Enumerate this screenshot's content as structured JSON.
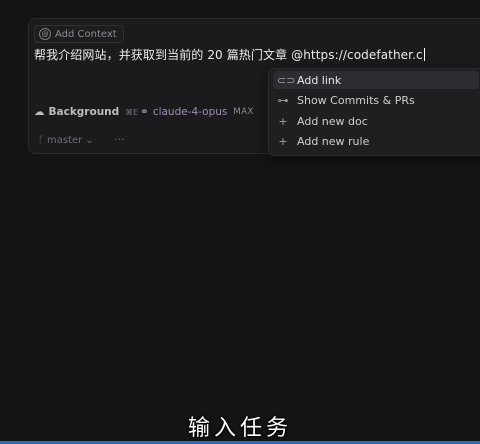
{
  "context": {
    "label": "Add Context",
    "icon": "at-icon"
  },
  "prompt": {
    "text": "帮我介绍网站，并获取到当前的 20 篇热门文章 @https://codefather.c"
  },
  "toolbar": {
    "background_label": "Background",
    "background_shortcut": "⌘E",
    "model_label": "claude-4-opus",
    "model_badge": "MAX"
  },
  "footer": {
    "branch": "master",
    "more": "···"
  },
  "menu": {
    "items": [
      {
        "label": "Add link",
        "icon": "link-icon",
        "active": true
      },
      {
        "label": "Show Commits & PRs",
        "icon": "commit-icon",
        "active": false
      },
      {
        "label": "Add new doc",
        "icon": "plus-icon",
        "active": false
      },
      {
        "label": "Add new rule",
        "icon": "plus-icon",
        "active": false
      }
    ]
  },
  "subtitle": "输入任务"
}
